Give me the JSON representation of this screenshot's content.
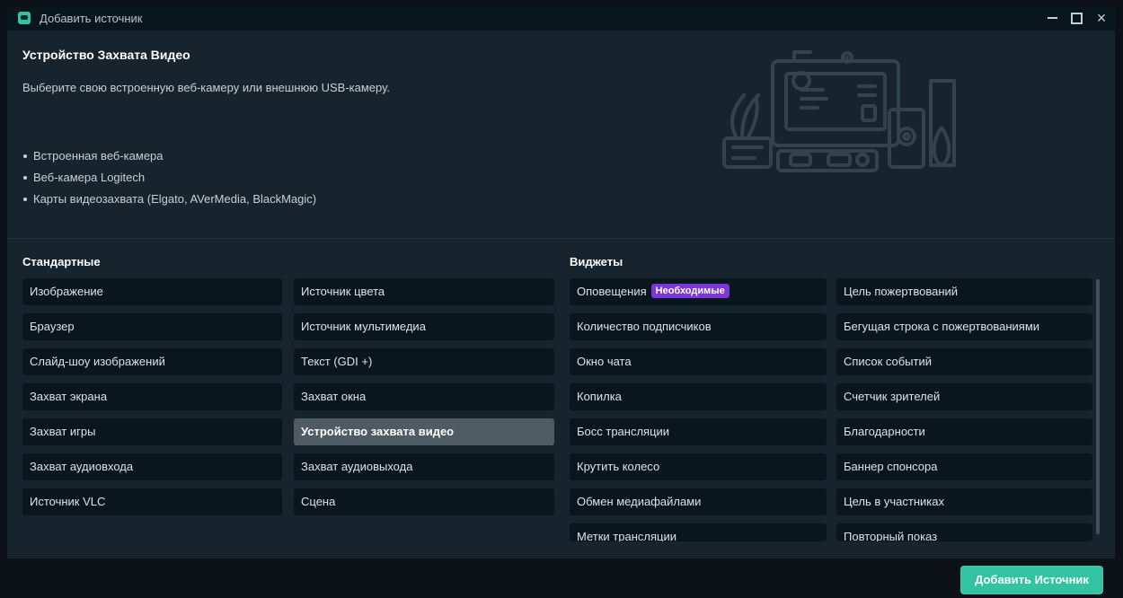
{
  "window": {
    "title": "Добавить источник",
    "close_label": "×",
    "accent": "#31c3a2"
  },
  "header": {
    "title": "Устройство Захвата Видео",
    "description": "Выберите свою встроенную веб-камеру или внешнюю USB-камеру.",
    "features": [
      "Встроенная веб-камера",
      "Веб-камера Logitech",
      "Карты видеозахвата (Elgato, AVerMedia, BlackMagic)"
    ]
  },
  "standard": {
    "title": "Стандартные",
    "left": [
      "Изображение",
      "Браузер",
      "Слайд-шоу изображений",
      "Захват экрана",
      "Захват игры",
      "Захват аудиовхода",
      "Источник VLC"
    ],
    "right": [
      "Источник цвета",
      "Источник мультимедиа",
      "Текст (GDI +)",
      "Захват окна",
      "Устройство захвата видео",
      "Захват аудиовыхода",
      "Сцена"
    ],
    "selected": "Устройство захвата видео"
  },
  "widgets": {
    "title": "Виджеты",
    "badge": "Необходимые",
    "left": [
      "Оповещения",
      "Количество подписчиков",
      "Окно чата",
      "Копилка",
      "Босс трансляции",
      "Крутить колесо",
      "Обмен медиафайлами",
      "Метки трансляции"
    ],
    "right": [
      "Цель пожертвований",
      "Бегущая строка с пожертвованиями",
      "Список событий",
      "Счетчик зрителей",
      "Благодарности",
      "Баннер спонсора",
      "Цель в участниках",
      "Повторный показ"
    ]
  },
  "footer": {
    "add_button": "Добавить Источник"
  }
}
